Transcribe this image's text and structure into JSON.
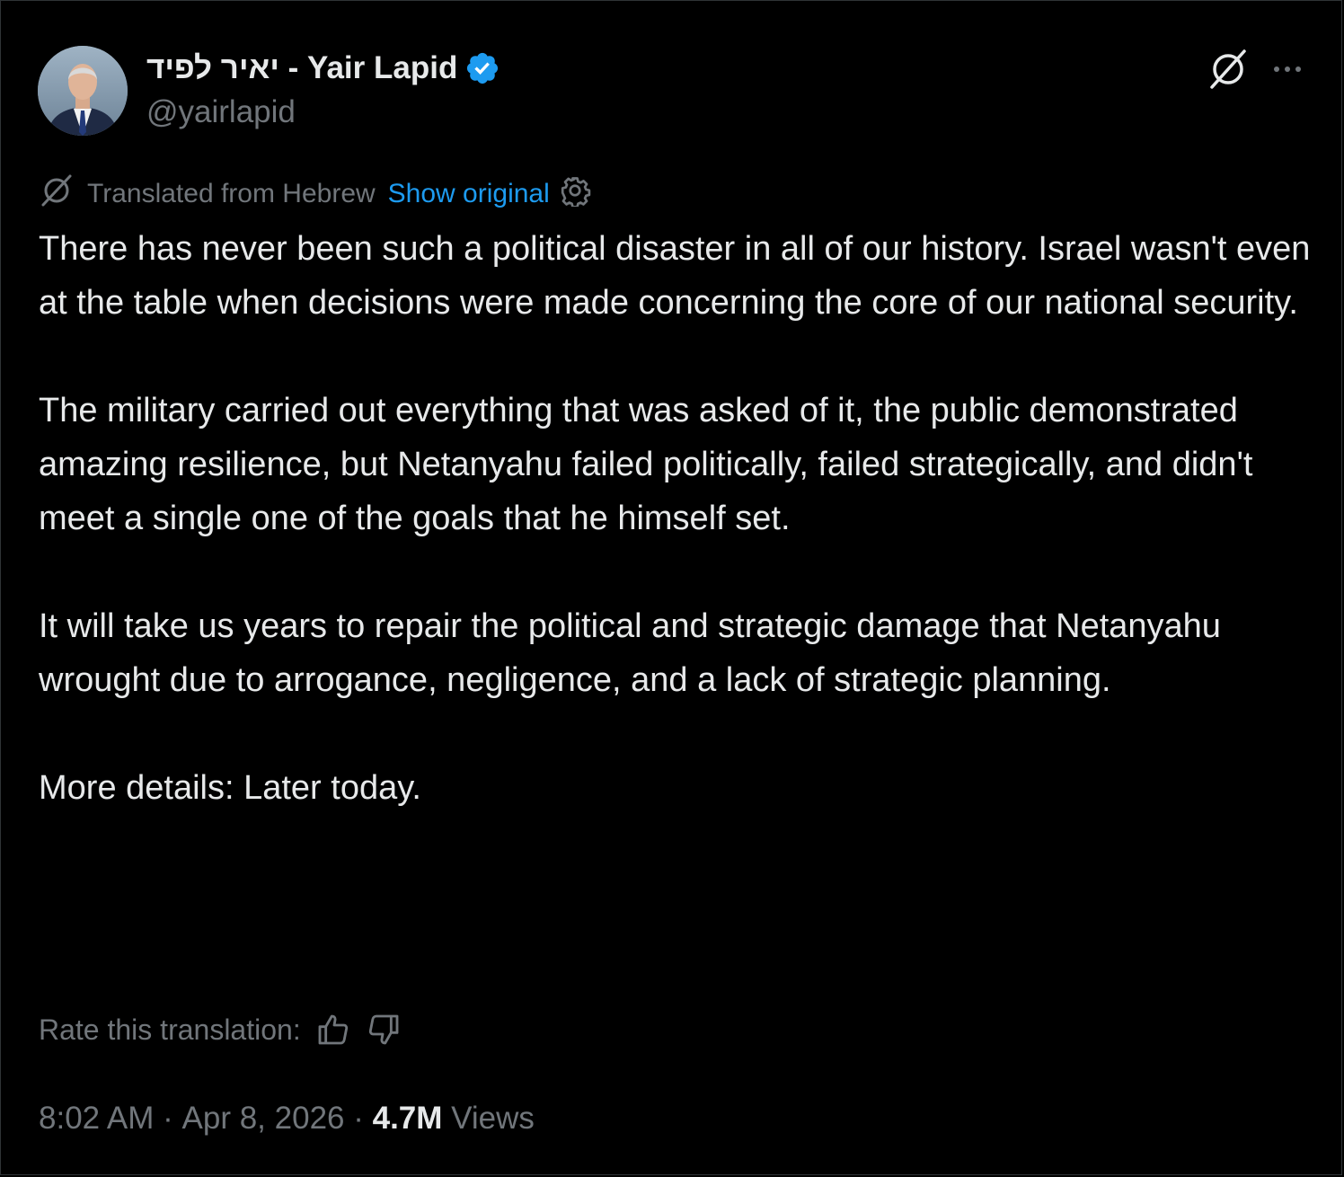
{
  "author": {
    "display_name": "יאיר לפיד - Yair Lapid",
    "handle": "@yairlapid",
    "verified": true,
    "verified_color": "#1d9bf0"
  },
  "header_actions": {
    "grok_icon": "grok-icon",
    "more_icon": "more-icon"
  },
  "translation": {
    "label": "Translated from Hebrew",
    "show_original": "Show original"
  },
  "tweet": {
    "paragraphs": [
      "There has never been such a political disaster in all of our history. Israel wasn't even at the table when decisions were made concerning the core of our national security.",
      "The military carried out everything that was asked of it, the public demonstrated amazing resilience, but Netanyahu failed politically, failed strategically, and didn't meet a single one of the goals that he himself set.",
      "It will take us years to repair the political and strategic damage that Netanyahu wrought due to arrogance, negligence, and a lack of strategic planning.",
      "More details: Later today."
    ]
  },
  "rating": {
    "label": "Rate this translation:"
  },
  "meta": {
    "time": "8:02 AM",
    "separator": " · ",
    "date": "Apr 8, 2026",
    "views_count": "4.7M",
    "views_label": " Views"
  },
  "colors": {
    "background": "#000000",
    "text_primary": "#e7e9ea",
    "text_secondary": "#71767b",
    "link": "#1d9bf0"
  }
}
